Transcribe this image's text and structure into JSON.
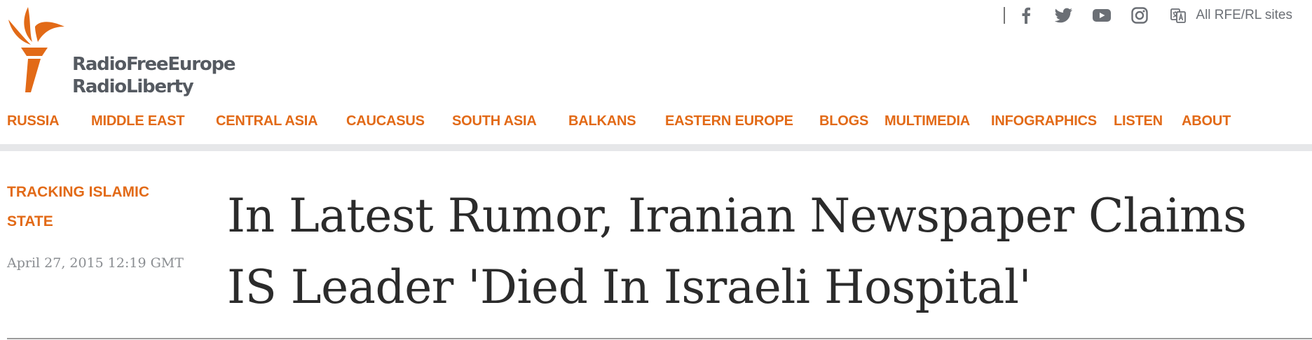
{
  "logo": {
    "line1": "RadioFreeEurope",
    "line2": "RadioLiberty",
    "brand_color": "#e26a17",
    "text_color": "#555a61"
  },
  "header": {
    "social_icons": [
      "facebook-icon",
      "twitter-icon",
      "youtube-icon",
      "instagram-icon"
    ],
    "all_sites_label": "All RFE/RL sites"
  },
  "nav": {
    "items": [
      "RUSSIA",
      "MIDDLE EAST",
      "CENTRAL ASIA",
      "CAUCASUS",
      "SOUTH ASIA",
      "BALKANS",
      "EASTERN EUROPE",
      "BLOGS",
      "MULTIMEDIA",
      "INFOGRAPHICS",
      "LISTEN",
      "ABOUT"
    ]
  },
  "article": {
    "category": "TRACKING ISLAMIC STATE",
    "date": "April 27, 2015 12:19 GMT",
    "title": "In Latest Rumor, Iranian Newspaper Claims IS Leader 'Died In Israeli Hospital'"
  }
}
